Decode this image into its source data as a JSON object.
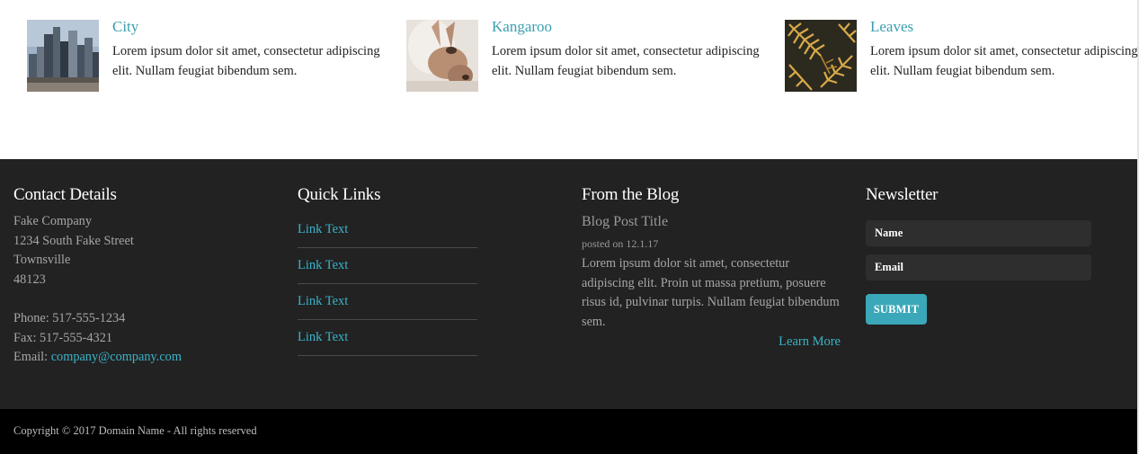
{
  "features": [
    {
      "title": "City",
      "description": "Lorem ipsum dolor sit amet, consectetur adipiscing elit. Nullam feugiat bibendum sem.",
      "image": "city-skyline-photo"
    },
    {
      "title": "Kangaroo",
      "description": "Lorem ipsum dolor sit amet, consectetur adipiscing elit. Nullam feugiat bibendum sem.",
      "image": "kangaroo-photo"
    },
    {
      "title": "Leaves",
      "description": "Lorem ipsum dolor sit amet, consectetur adipiscing elit. Nullam feugiat bibendum sem.",
      "image": "fern-leaves-photo"
    }
  ],
  "footer": {
    "contact": {
      "heading": "Contact Details",
      "company": "Fake Company",
      "street": "1234 South Fake Street",
      "city": "Townsville",
      "zip": "48123",
      "phone": "Phone: 517-555-1234",
      "fax": "Fax: 517-555-4321",
      "email_label": "Email: ",
      "email": "company@company.com"
    },
    "quick_links": {
      "heading": "Quick Links",
      "links": [
        "Link Text",
        "Link Text",
        "Link Text",
        "Link Text"
      ]
    },
    "blog": {
      "heading": "From the Blog",
      "post_title": "Blog Post Title",
      "posted": "posted on 12.1.17",
      "excerpt": "Lorem ipsum dolor sit amet, consectetur adipiscing elit. Proin ut massa pretium, posuere risus id, pulvinar turpis. Nullam feugiat bibendum sem.",
      "more": "Learn More"
    },
    "newsletter": {
      "heading": "Newsletter",
      "name_placeholder": "Name",
      "email_placeholder": "Email",
      "submit": "SUBMIT"
    }
  },
  "copyright": "Copyright © 2017 Domain Name - All rights reserved",
  "colors": {
    "accent": "#3ab3c8",
    "footer_bg": "#222222",
    "copyright_bg": "#000000",
    "button_bg": "#3aa8b8"
  }
}
